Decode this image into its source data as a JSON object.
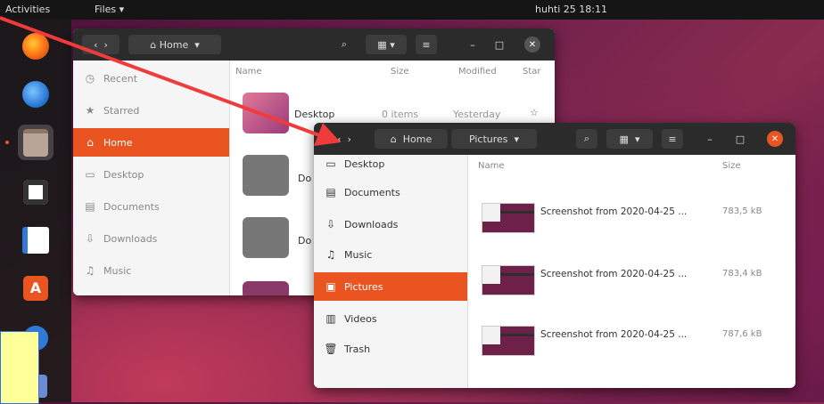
{
  "topbar": {
    "activities": "Activities",
    "app_menu": "Files ▾",
    "clock": "huhti 25 18:11"
  },
  "dock": {
    "items": [
      {
        "name": "firefox",
        "icon": "firefox-icon",
        "color": "#e66000"
      },
      {
        "name": "thunderbird",
        "icon": "mail-icon",
        "color": "#2a7de1"
      },
      {
        "name": "files",
        "icon": "files-icon",
        "color": "#a08a7a"
      },
      {
        "name": "rhythmbox",
        "icon": "music-icon",
        "color": "#f3c31a"
      },
      {
        "name": "writer",
        "icon": "document-icon",
        "color": "#2f7ad8"
      },
      {
        "name": "software",
        "icon": "software-icon",
        "color": "#e95420"
      },
      {
        "name": "help",
        "icon": "help-icon",
        "color": "#2f7ad8"
      }
    ]
  },
  "back_window": {
    "path_label": "Home",
    "columns": {
      "name": "Name",
      "size": "Size",
      "modified": "Modified",
      "star": "Star"
    },
    "sidebar": [
      "Recent",
      "Starred",
      "Home",
      "Desktop",
      "Documents",
      "Downloads",
      "Music"
    ],
    "selected": "Home",
    "rows": [
      {
        "name": "Desktop",
        "size": "0 items",
        "modified": "Yesterday"
      },
      {
        "name": "Do",
        "size": "",
        "modified": ""
      },
      {
        "name": "Do",
        "size": "",
        "modified": ""
      }
    ]
  },
  "front_window": {
    "path_home": "Home",
    "path_current": "Pictures",
    "columns": {
      "name": "Name",
      "size": "Size"
    },
    "sidebar": [
      {
        "label": "Desktop",
        "icon": "desktop-icon"
      },
      {
        "label": "Documents",
        "icon": "documents-icon"
      },
      {
        "label": "Downloads",
        "icon": "downloads-icon"
      },
      {
        "label": "Music",
        "icon": "music-icon"
      },
      {
        "label": "Pictures",
        "icon": "pictures-icon"
      },
      {
        "label": "Videos",
        "icon": "videos-icon"
      },
      {
        "label": "Trash",
        "icon": "trash-icon"
      }
    ],
    "selected": "Pictures",
    "files": [
      {
        "name": "Screenshot from 2020-04-25 ...",
        "size": "783,5 kB"
      },
      {
        "name": "Screenshot from 2020-04-25 ...",
        "size": "783,4 kB"
      },
      {
        "name": "Screenshot from 2020-04-25 ...",
        "size": "787,6 kB"
      }
    ]
  },
  "colors": {
    "accent": "#e95420",
    "header": "#2b2b2b",
    "arrow": "#ef3b3b",
    "note": "#ffff99"
  }
}
